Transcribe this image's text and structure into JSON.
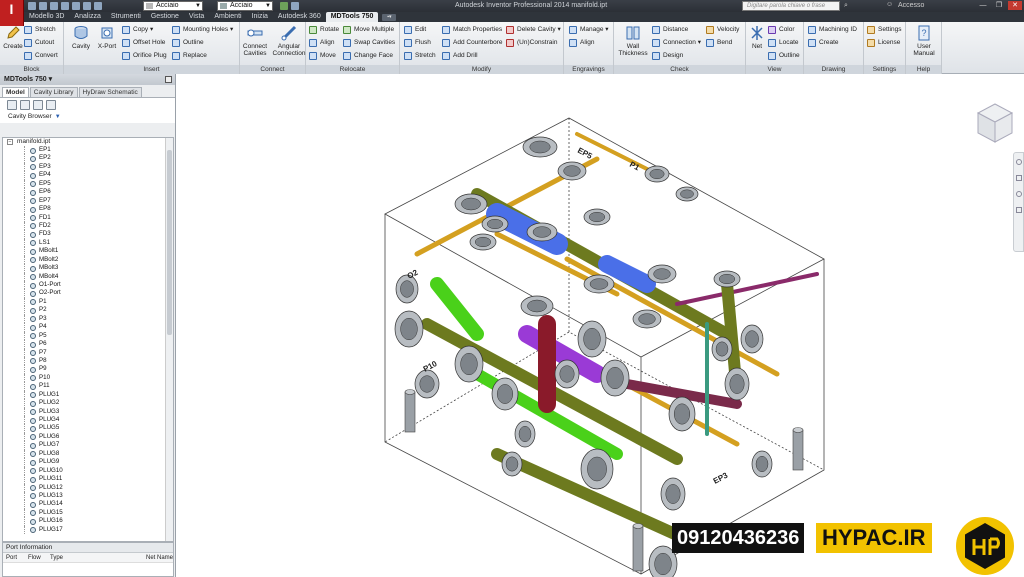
{
  "titlebar": {
    "material_combo": "Acciaio",
    "appearance_combo": "Acciaio",
    "window_title": "Autodesk Inventor Professional 2014   manifold.ipt",
    "search_placeholder": "Digitare parola chiave o frase",
    "signin": "Accesso"
  },
  "ribbon_tabs": [
    "Modello 3D",
    "Analizza",
    "Strumenti",
    "Gestione",
    "Vista",
    "Ambienti",
    "Inizia",
    "Autodesk 360",
    "MDTools 750"
  ],
  "active_tab": "MDTools 750",
  "panels": {
    "block": {
      "title": "Block",
      "create": "Create",
      "stretch": "Stretch",
      "cutout": "Cutout",
      "convert": "Convert"
    },
    "insert": {
      "title": "Insert",
      "cavity": "Cavity",
      "xport": "X-Port",
      "copy": "Copy",
      "offset_hole": "Offset Hole",
      "orifice_plug": "Orifice Plug",
      "mounting_holes": "Mounting Holes",
      "outline": "Outline",
      "replace": "Replace"
    },
    "connect": {
      "title": "Connect",
      "connect_cavities": "Connect Cavities",
      "angular_connection": "Angular Connection"
    },
    "relocate": {
      "title": "Relocate",
      "rotate": "Rotate",
      "align": "Align",
      "move": "Move",
      "move_multiple": "Move Multiple",
      "swap_cavities": "Swap Cavities",
      "change_face": "Change Face"
    },
    "modify": {
      "title": "Modify",
      "edit": "Edit",
      "flush": "Flush",
      "stretch": "Stretch",
      "match_properties": "Match Properties",
      "add_counterbore": "Add Counterbore",
      "add_drill": "Add Drill",
      "delete_cavity": "Delete Cavity",
      "unconstrain": "(Un)Constrain"
    },
    "engravings": {
      "title": "Engravings",
      "manage": "Manage",
      "align": "Align"
    },
    "check": {
      "title": "Check",
      "wall_thickness": "Wall Thickness",
      "distance": "Distance",
      "connection": "Connection",
      "design": "Design",
      "velocity": "Velocity",
      "bend": "Bend"
    },
    "view": {
      "title": "View",
      "net": "Net",
      "color": "Color",
      "locate": "Locate",
      "outline": "Outline"
    },
    "drawing": {
      "title": "Drawing",
      "machining_id": "Machining ID",
      "create": "Create"
    },
    "settings": {
      "title": "Settings",
      "settings": "Settings",
      "license": "License"
    },
    "help": {
      "title": "Help",
      "user_manual": "User Manual"
    }
  },
  "browser": {
    "title": "MDTools 750",
    "tabs": [
      "Model",
      "Cavity Library",
      "HyDraw Schematic"
    ],
    "active_tab": "Model",
    "cavity_browser_label": "Cavity Browser",
    "root": "manifold.ipt",
    "items": [
      "EP1",
      "EP2",
      "EP3",
      "EP4",
      "EP5",
      "EP6",
      "EP7",
      "EP8",
      "FD1",
      "FD2",
      "FD3",
      "LS1",
      "MBolt1",
      "MBolt2",
      "MBolt3",
      "MBolt4",
      "O1-Port",
      "O2-Port",
      "P1",
      "P2",
      "P3",
      "P4",
      "P5",
      "P6",
      "P7",
      "P8",
      "P9",
      "P10",
      "P11",
      "PLUG1",
      "PLUG2",
      "PLUG3",
      "PLUG4",
      "PLUG5",
      "PLUG6",
      "PLUG7",
      "PLUG8",
      "PLUG9",
      "PLUG10",
      "PLUG11",
      "PLUG12",
      "PLUG13",
      "PLUG14",
      "PLUG15",
      "PLUG16",
      "PLUG17"
    ]
  },
  "port_info": {
    "title": "Port Information",
    "columns": [
      "Port",
      "Flow",
      "Type",
      "Net Name"
    ]
  },
  "watermark": {
    "phone": "09120436236",
    "site": "HYPAC.IR"
  },
  "model_labels": [
    "EP5",
    "P1",
    "O2",
    "P10",
    "EP3"
  ],
  "colors": {
    "accent_red": "#c02020",
    "ribbon_dark": "#2f343b",
    "watermark_yellow": "#f2c200"
  }
}
